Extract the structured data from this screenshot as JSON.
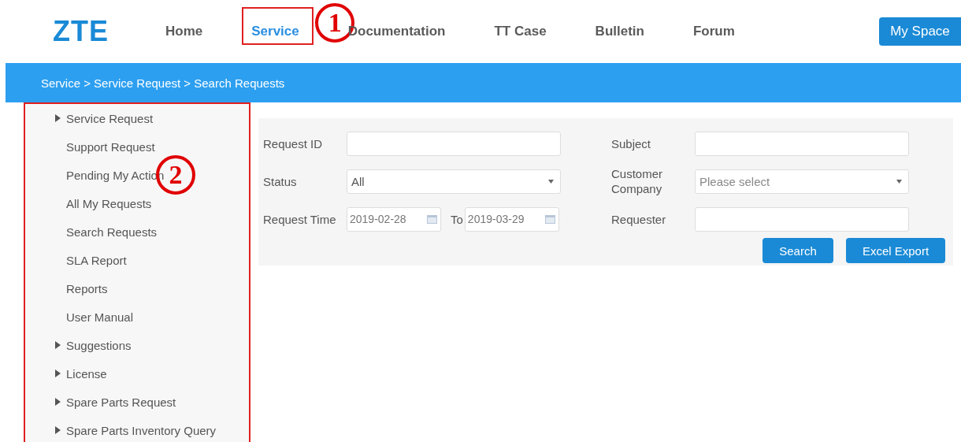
{
  "logo": "ZTE",
  "nav": [
    {
      "label": "Home",
      "selected": false
    },
    {
      "label": "Service",
      "selected": true
    },
    {
      "label": "Documentation",
      "selected": false
    },
    {
      "label": "TT Case",
      "selected": false
    },
    {
      "label": "Bulletin",
      "selected": false
    },
    {
      "label": "Forum",
      "selected": false
    }
  ],
  "my_space_button": "My Space",
  "breadcrumb": "Service > Service Request > Search Requests",
  "sidebar": {
    "items": [
      {
        "label": "Service Request",
        "children": [
          {
            "label": "Support Request"
          },
          {
            "label": "Pending My Action"
          },
          {
            "label": "All My Requests"
          },
          {
            "label": "Search Requests"
          },
          {
            "label": "SLA Report"
          },
          {
            "label": "Reports"
          },
          {
            "label": "User Manual"
          }
        ]
      },
      {
        "label": "Suggestions"
      },
      {
        "label": "License"
      },
      {
        "label": "Spare Parts Request"
      },
      {
        "label": "Spare Parts Inventory Query"
      }
    ]
  },
  "form": {
    "request_id": {
      "label": "Request ID"
    },
    "subject": {
      "label": "Subject"
    },
    "status": {
      "label": "Status",
      "value": "All"
    },
    "customer_company": {
      "label": "Customer Company",
      "placeholder": "Please select"
    },
    "request_time": {
      "label": "Request Time",
      "from": "2019-02-28",
      "to_label": "To",
      "to": "2019-03-29"
    },
    "requester": {
      "label": "Requester"
    },
    "buttons": [
      "Search",
      "Excel Export"
    ]
  },
  "annotations": [
    {
      "kind": "nav",
      "label": "1"
    },
    {
      "kind": "sidebar",
      "label": "2"
    }
  ]
}
